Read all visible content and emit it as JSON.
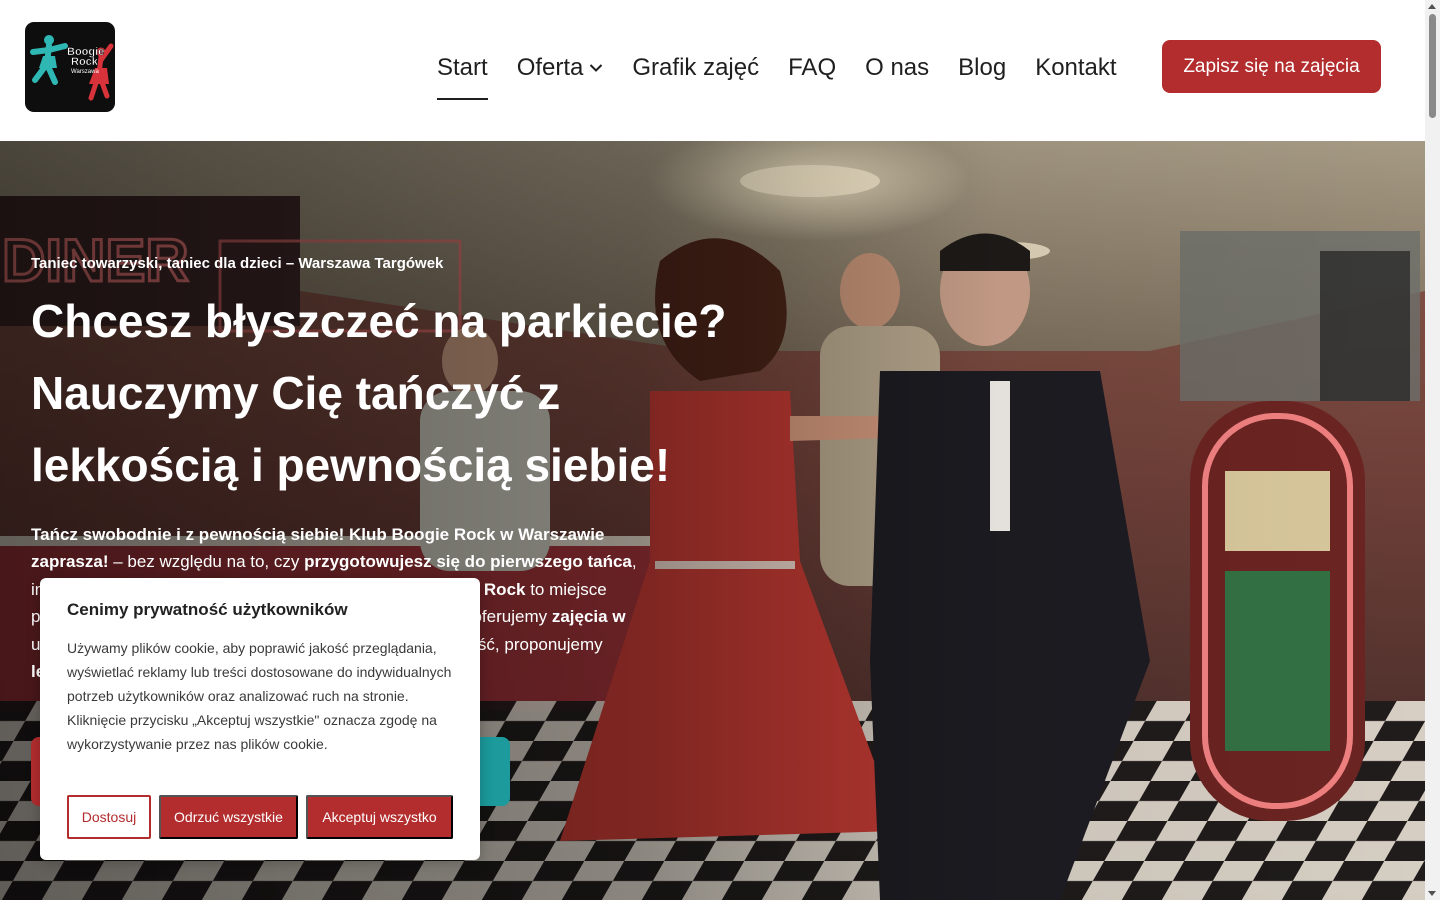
{
  "logo": {
    "line1": "Boogie",
    "line2": "Rock",
    "line3": "Warszawa",
    "icon": "dancers-logo"
  },
  "nav": {
    "items": [
      "Start",
      "Oferta",
      "Grafik zajęć",
      "FAQ",
      "O nas",
      "Blog",
      "Kontakt"
    ],
    "active": "Start",
    "cta": "Zapisz się na zajęcia"
  },
  "hero": {
    "eyebrow": "Taniec towarzyski, taniec dla dzieci – Warszawa Targówek",
    "title_lines": [
      "Chcesz błyszczeć na parkiecie?",
      "Nauczymy Cię tańczyć z",
      "lekkością i pewnością siebie!"
    ],
    "paragraph": {
      "p1_bold": "Tańcz swobodnie i z pewnością siebie! Klub Boogie Rock w Warszawie zaprasza!",
      "p2": " – bez względu na to, czy ",
      "p3_bold": "przygotowujesz się do pierwszego tańca",
      "p4": ",",
      "line3_start": "in",
      "line3_bold": "ogie Rock",
      "line3_end": " to miejsce",
      "line4_start": "p",
      "line4_mid": "oferujemy ",
      "line4_bold": "zajęcia w",
      "line5_start": "u",
      "line5_end": "ość, proponujemy",
      "line6_start": "le"
    },
    "background": {
      "scene": "1950s diner dance couple",
      "colors": {
        "dress": "#c23a33",
        "suit": "#1c1c22",
        "neon": "#e85a5a"
      }
    }
  },
  "cookie": {
    "title": "Cenimy prywatność użytkowników",
    "text": "Używamy plików cookie, aby poprawić jakość przeglądania, wyświetlać reklamy lub treści dostosowane do indywidualnych potrzeb użytkowników oraz analizować ruch na stronie. Kliknięcie przycisku „Akceptuj wszystkie\" oznacza zgodę na wykorzystywanie przez nas plików cookie.",
    "customize": "Dostosuj",
    "reject": "Odrzuć wszystkie",
    "accept": "Akceptuj wszystko"
  },
  "colors": {
    "brand_red": "#b32d2e",
    "brand_teal": "#1c9a9c",
    "text_dark": "#1f1f1f"
  }
}
